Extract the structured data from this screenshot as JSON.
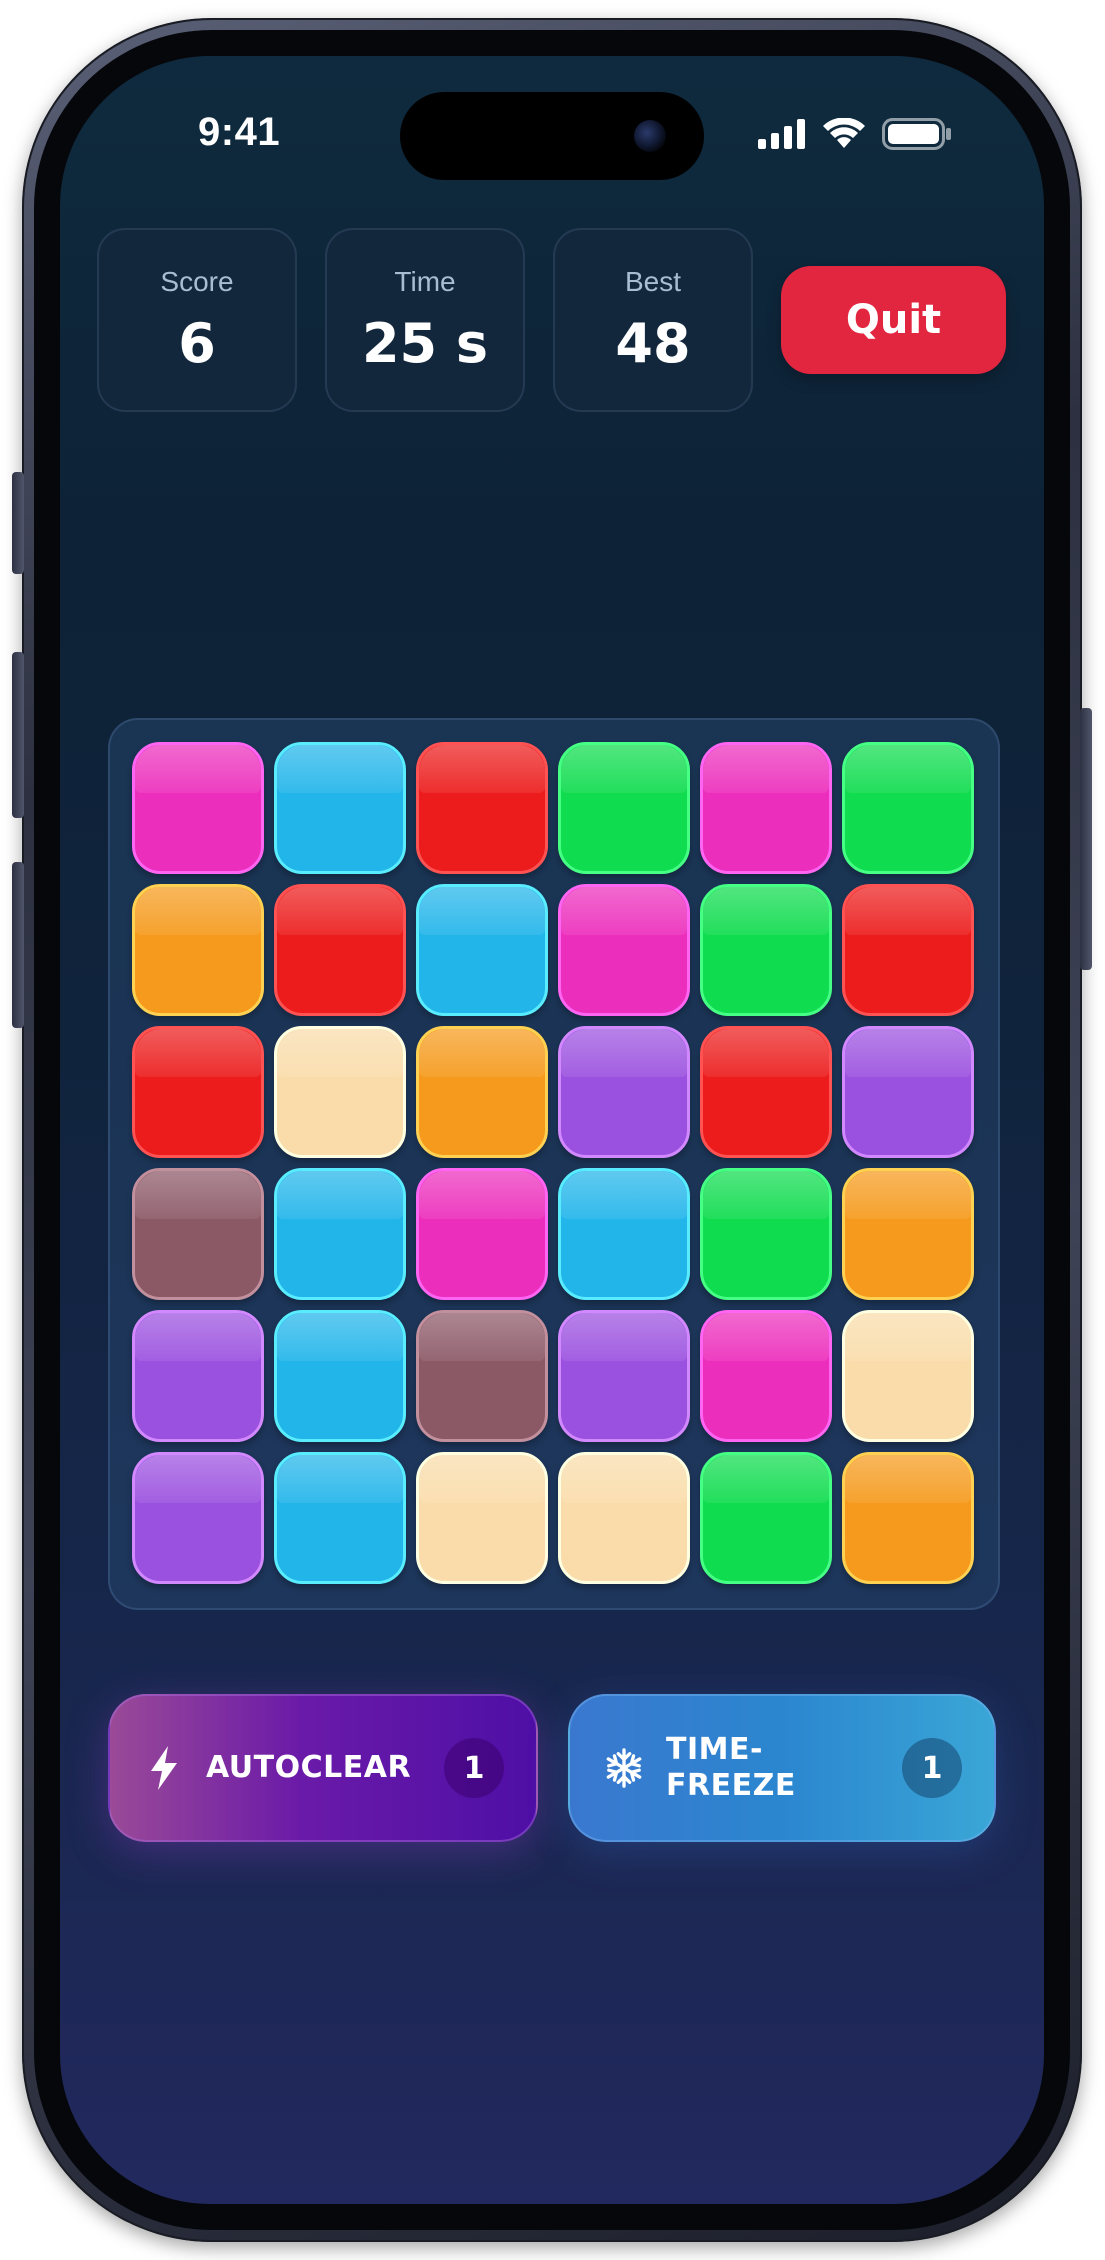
{
  "status_bar": {
    "time": "9:41"
  },
  "stats": [
    {
      "label": "Score",
      "value": "6"
    },
    {
      "label": "Time",
      "value": "25 s"
    },
    {
      "label": "Best",
      "value": "48"
    }
  ],
  "quit_label": "Quit",
  "board": {
    "rows": [
      [
        "magenta",
        "cyan",
        "red",
        "green",
        "magenta",
        "green"
      ],
      [
        "orange",
        "red",
        "cyan",
        "magenta",
        "green",
        "red"
      ],
      [
        "red",
        "cream",
        "orange",
        "purple",
        "red",
        "purple"
      ],
      [
        "mauve",
        "cyan",
        "magenta",
        "cyan",
        "green",
        "orange"
      ],
      [
        "purple",
        "cyan",
        "mauve",
        "purple",
        "magenta",
        "cream"
      ],
      [
        "purple",
        "cyan",
        "cream",
        "cream",
        "green",
        "orange"
      ]
    ],
    "colors": {
      "magenta": "#ec2ebc",
      "cyan": "#22b5ea",
      "red": "#ec1c1c",
      "green": "#0fdc4e",
      "orange": "#f59a1c",
      "cream": "#f9dcaa",
      "purple": "#9b51df",
      "mauve": "#8b5866"
    }
  },
  "powerups": {
    "autoclear": {
      "icon": "lightning-icon",
      "label": "AUTOCLEAR",
      "count": "1"
    },
    "timefreeze": {
      "icon": "snowflake-icon",
      "label_line1": "TIME-",
      "label_line2": "FREEZE",
      "count": "1"
    }
  }
}
